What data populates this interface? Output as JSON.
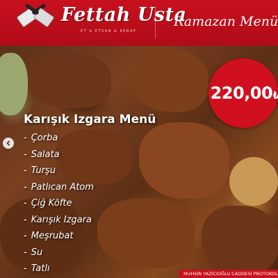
{
  "header": {
    "brand": "Fettah Usta",
    "tagline": "ET & ETSAN & KEBAP",
    "menu_title": "Ramazan Menüsü"
  },
  "price": {
    "amount": "220,00",
    "currency_symbol": "₺"
  },
  "menu": {
    "heading": "Karışık Izgara Menü",
    "items": [
      "Çorba",
      "Salata",
      "Turşu",
      "Patlıcan Atom",
      "Çiğ Köfte",
      "Karışık Izgara",
      "Meşrubat",
      "Su",
      "Tatlı"
    ]
  },
  "footer": {
    "address": "MUHSİN YAZICIOĞLU CADDESİ PROTOKOL YOLU"
  },
  "icons": {
    "logo": "crossed-cleavers-icon",
    "carousel_prev": "chevron-left-icon"
  },
  "colors": {
    "brand_red": "#c8101e",
    "text": "#ffffff"
  }
}
